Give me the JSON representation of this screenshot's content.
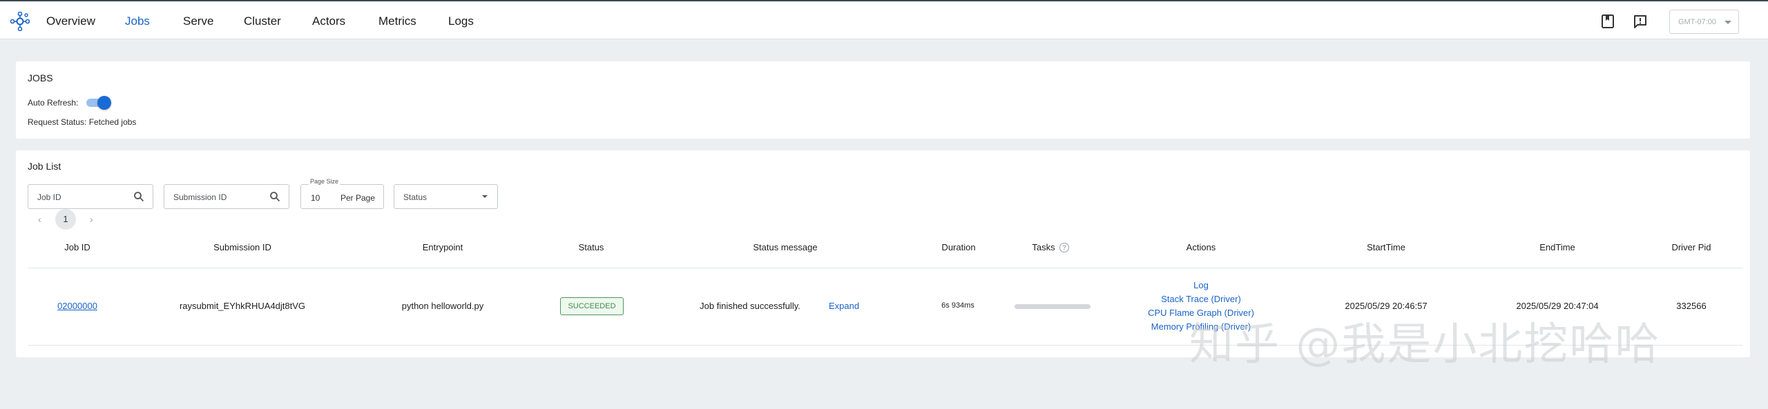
{
  "nav": {
    "items": [
      {
        "label": "Overview",
        "active": false
      },
      {
        "label": "Jobs",
        "active": true
      },
      {
        "label": "Serve",
        "active": false
      },
      {
        "label": "Cluster",
        "active": false
      },
      {
        "label": "Actors",
        "active": false
      },
      {
        "label": "Metrics",
        "active": false
      },
      {
        "label": "Logs",
        "active": false
      }
    ],
    "timezone": "GMT-07:00",
    "accent_color": "#1a63c7",
    "icons": [
      "ray-logo-icon",
      "docs-icon",
      "feedback-icon"
    ]
  },
  "jobs_panel": {
    "title": "JOBS",
    "auto_refresh_label": "Auto Refresh:",
    "auto_refresh_on": true,
    "request_status": "Request Status: Fetched jobs"
  },
  "job_list": {
    "title": "Job List",
    "filters": {
      "job_id_placeholder": "Job ID",
      "submission_id_placeholder": "Submission ID",
      "page_size_label": "Page Size",
      "page_size_value": "10",
      "page_size_unit": "Per Page",
      "status_placeholder": "Status"
    },
    "pagination": {
      "current_page": "1"
    },
    "columns": [
      "Job ID",
      "Submission ID",
      "Entrypoint",
      "Status",
      "Status message",
      "Duration",
      "Tasks",
      "Actions",
      "StartTime",
      "EndTime",
      "Driver Pid"
    ],
    "rows": [
      {
        "job_id": "02000000",
        "submission_id": "raysubmit_EYhkRHUA4djt8tVG",
        "entrypoint": "python helloworld.py",
        "status": "SUCCEEDED",
        "status_message": "Job finished successfully.",
        "expand_label": "Expand",
        "duration": "6s 934ms",
        "tasks_progress": 0,
        "actions": [
          "Log",
          "Stack Trace (Driver)",
          "CPU Flame Graph (Driver)",
          "Memory Profiling (Driver)"
        ],
        "start_time": "2025/05/29 20:46:57",
        "end_time": "2025/05/29 20:47:04",
        "driver_pid": "332566"
      }
    ]
  },
  "watermark": "知乎 @我是小北挖哈哈"
}
